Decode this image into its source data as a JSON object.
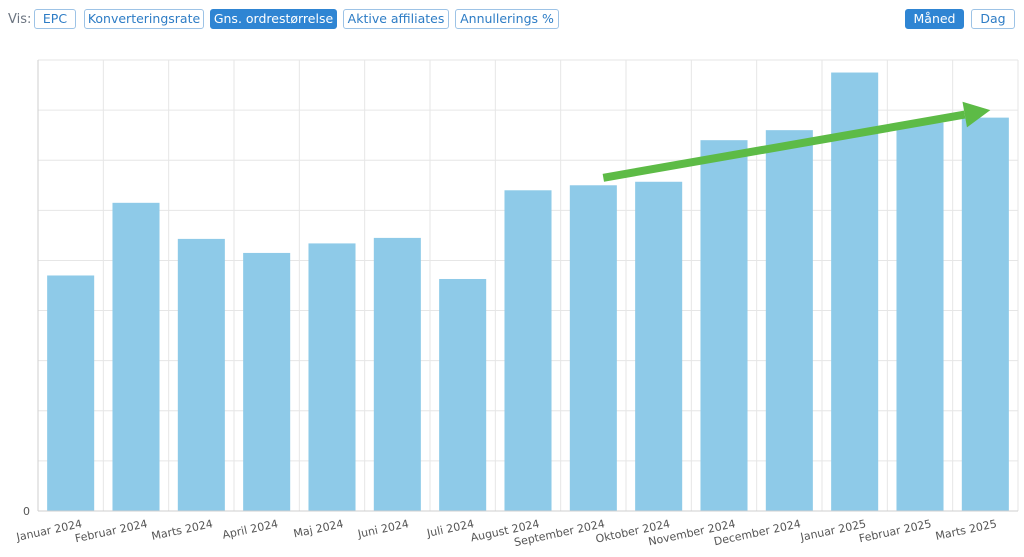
{
  "toolbar": {
    "vis_label": "Vis:",
    "metric_buttons": [
      "EPC",
      "Konverteringsrate",
      "Gns. ordrestørrelse",
      "Aktive affiliates",
      "Annullerings %"
    ],
    "active_metric": "Gns. ordrestørrelse",
    "period_buttons": [
      "Måned",
      "Dag"
    ],
    "active_period": "Måned"
  },
  "colors": {
    "bar": "#8ecae8",
    "arrow": "#5dbb46",
    "grid": "#e6e6e6",
    "accent": "#2f85d3"
  },
  "chart_data": {
    "type": "bar",
    "categories": [
      "Januar 2024",
      "Februar 2024",
      "Marts 2024",
      "April 2024",
      "Maj 2024",
      "Juni 2024",
      "Juli 2024",
      "August 2024",
      "September 2024",
      "Oktober 2024",
      "November 2024",
      "December 2024",
      "Januar 2025",
      "Februar 2025",
      "Marts 2025"
    ],
    "values": [
      4.7,
      6.15,
      5.43,
      5.15,
      5.34,
      5.45,
      4.63,
      6.4,
      6.5,
      6.57,
      7.4,
      7.6,
      8.75,
      7.75,
      7.85
    ],
    "ylim": [
      0,
      9
    ],
    "ytick_labels": [
      "0"
    ],
    "grid": true,
    "annotations": [
      {
        "type": "arrow",
        "from": {
          "x": "September 2024",
          "y": 6.65
        },
        "to": {
          "x": "Marts 2025",
          "y": 8.0
        },
        "meaning": "upward trend"
      }
    ]
  }
}
